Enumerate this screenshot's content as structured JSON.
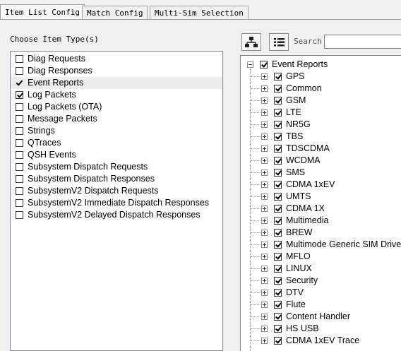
{
  "tabs": [
    {
      "label": "Item List Config",
      "active": true
    },
    {
      "label": "Match Config",
      "active": false
    },
    {
      "label": "Multi-Sim Selection",
      "active": false
    }
  ],
  "left_panel": {
    "title": "Choose Item Type(s)",
    "items": [
      {
        "label": "Diag Requests",
        "state": "unchecked"
      },
      {
        "label": "Diag Responses",
        "state": "unchecked"
      },
      {
        "label": "Event Reports",
        "state": "selected-check"
      },
      {
        "label": "Log Packets",
        "state": "checked"
      },
      {
        "label": "Log Packets (OTA)",
        "state": "unchecked"
      },
      {
        "label": "Message Packets",
        "state": "unchecked"
      },
      {
        "label": "Strings",
        "state": "unchecked"
      },
      {
        "label": "QTraces",
        "state": "unchecked"
      },
      {
        "label": "QSH Events",
        "state": "unchecked"
      },
      {
        "label": "Subsystem Dispatch Requests",
        "state": "unchecked"
      },
      {
        "label": "Subsystem Dispatch Responses",
        "state": "unchecked"
      },
      {
        "label": "SubsystemV2 Dispatch Requests",
        "state": "unchecked"
      },
      {
        "label": "SubsystemV2 Immediate Dispatch Responses",
        "state": "unchecked"
      },
      {
        "label": "SubsystemV2 Delayed Dispatch Responses",
        "state": "unchecked"
      }
    ]
  },
  "toolbar": {
    "tree_view_icon": "hierarchy-icon",
    "list_view_icon": "list-icon",
    "search_label": "Search",
    "search_value": ""
  },
  "tree": {
    "root": {
      "label": "Event Reports",
      "checked": true,
      "expanded": true
    },
    "children": [
      {
        "label": "GPS",
        "checked": true
      },
      {
        "label": "Common",
        "checked": true
      },
      {
        "label": "GSM",
        "checked": true
      },
      {
        "label": "LTE",
        "checked": true
      },
      {
        "label": "NR5G",
        "checked": true
      },
      {
        "label": "TBS",
        "checked": true
      },
      {
        "label": "TDSCDMA",
        "checked": true
      },
      {
        "label": "WCDMA",
        "checked": true
      },
      {
        "label": "SMS",
        "checked": true
      },
      {
        "label": "CDMA 1xEV",
        "checked": true
      },
      {
        "label": "UMTS",
        "checked": true
      },
      {
        "label": "CDMA 1X",
        "checked": true
      },
      {
        "label": "Multimedia",
        "checked": true
      },
      {
        "label": "BREW",
        "checked": true
      },
      {
        "label": "Multimode Generic SIM Drivers",
        "checked": true
      },
      {
        "label": "MFLO",
        "checked": true
      },
      {
        "label": "LINUX",
        "checked": true
      },
      {
        "label": "Security",
        "checked": true
      },
      {
        "label": "DTV",
        "checked": true
      },
      {
        "label": "Flute",
        "checked": true
      },
      {
        "label": "Content Handler",
        "checked": true
      },
      {
        "label": "HS USB",
        "checked": true
      },
      {
        "label": "CDMA 1xEV Trace",
        "checked": true
      }
    ]
  }
}
